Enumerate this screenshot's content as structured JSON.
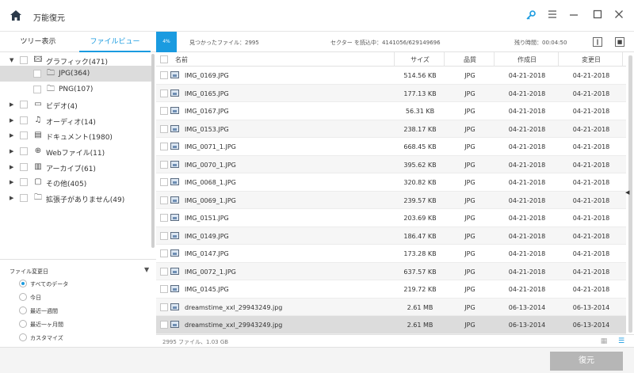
{
  "app": {
    "title": "万能復元"
  },
  "icons": {
    "home": "home-icon",
    "key": "key-icon",
    "menu": "menu-icon",
    "minimize": "minimize-icon",
    "maximize": "maximize-icon",
    "close": "close-icon"
  },
  "accent_color": "#1a9be0",
  "side_tabs": [
    {
      "label": "ツリー表示",
      "active": false
    },
    {
      "label": "ファイルビュー",
      "active": true
    }
  ],
  "tree": [
    {
      "label": "グラフィック(471)",
      "expanded": true,
      "icon": "image-folder-icon"
    },
    {
      "label": "JPG(364)",
      "child": true,
      "selected": true,
      "icon": "folder-icon"
    },
    {
      "label": "PNG(107)",
      "child": true,
      "icon": "folder-icon"
    },
    {
      "label": "ビデオ(4)",
      "icon": "video-icon"
    },
    {
      "label": "オーディオ(14)",
      "icon": "music-icon"
    },
    {
      "label": "ドキュメント(1980)",
      "icon": "document-icon"
    },
    {
      "label": "Webファイル(11)",
      "icon": "globe-icon"
    },
    {
      "label": "アーカイブ(61)",
      "icon": "archive-icon"
    },
    {
      "label": "その他(405)",
      "icon": "other-icon"
    },
    {
      "label": "拡張子がありません(49)",
      "icon": "no-extension-folder-icon"
    }
  ],
  "filter": {
    "title": "ファイル変更日",
    "options": [
      {
        "label": "すべてのデータ",
        "selected": true
      },
      {
        "label": "今日",
        "selected": false
      },
      {
        "label": "最近一週間",
        "selected": false
      },
      {
        "label": "最近一ヶ月間",
        "selected": false
      },
      {
        "label": "カスタマイズ",
        "selected": false
      }
    ]
  },
  "status": {
    "progress": "4%",
    "found": "見つかったファイル：2995",
    "sectors": "セクター を読込中：4141056/629149696",
    "remaining": "残り時間：00:04:50"
  },
  "table": {
    "columns": [
      "名前",
      "サイズ",
      "品質",
      "作成日",
      "変更日"
    ],
    "rows": [
      {
        "name": "IMG_0169.JPG",
        "size": "514.56 KB",
        "quality": "JPG",
        "created": "04-21-2018",
        "modified": "04-21-2018"
      },
      {
        "name": "IMG_0165.JPG",
        "size": "177.13 KB",
        "quality": "JPG",
        "created": "04-21-2018",
        "modified": "04-21-2018"
      },
      {
        "name": "IMG_0167.JPG",
        "size": "56.31 KB",
        "quality": "JPG",
        "created": "04-21-2018",
        "modified": "04-21-2018"
      },
      {
        "name": "IMG_0153.JPG",
        "size": "238.17 KB",
        "quality": "JPG",
        "created": "04-21-2018",
        "modified": "04-21-2018"
      },
      {
        "name": "IMG_0071_1.JPG",
        "size": "668.45 KB",
        "quality": "JPG",
        "created": "04-21-2018",
        "modified": "04-21-2018"
      },
      {
        "name": "IMG_0070_1.JPG",
        "size": "395.62 KB",
        "quality": "JPG",
        "created": "04-21-2018",
        "modified": "04-21-2018"
      },
      {
        "name": "IMG_0068_1.JPG",
        "size": "320.82 KB",
        "quality": "JPG",
        "created": "04-21-2018",
        "modified": "04-21-2018"
      },
      {
        "name": "IMG_0069_1.JPG",
        "size": "239.57 KB",
        "quality": "JPG",
        "created": "04-21-2018",
        "modified": "04-21-2018"
      },
      {
        "name": "IMG_0151.JPG",
        "size": "203.69 KB",
        "quality": "JPG",
        "created": "04-21-2018",
        "modified": "04-21-2018"
      },
      {
        "name": "IMG_0149.JPG",
        "size": "186.47 KB",
        "quality": "JPG",
        "created": "04-21-2018",
        "modified": "04-21-2018"
      },
      {
        "name": "IMG_0147.JPG",
        "size": "173.28 KB",
        "quality": "JPG",
        "created": "04-21-2018",
        "modified": "04-21-2018"
      },
      {
        "name": "IMG_0072_1.JPG",
        "size": "637.57 KB",
        "quality": "JPG",
        "created": "04-21-2018",
        "modified": "04-21-2018"
      },
      {
        "name": "IMG_0145.JPG",
        "size": "219.72 KB",
        "quality": "JPG",
        "created": "04-21-2018",
        "modified": "04-21-2018"
      },
      {
        "name": "dreamstime_xxl_29943249.jpg",
        "size": "2.61 MB",
        "quality": "JPG",
        "created": "06-13-2014",
        "modified": "06-13-2014"
      },
      {
        "name": "dreamstime_xxl_29943249.jpg",
        "size": "2.61 MB",
        "quality": "JPG",
        "created": "06-13-2014",
        "modified": "06-13-2014",
        "selected": true
      }
    ]
  },
  "footer": {
    "summary": "2995 ファイル、1.03 GB"
  },
  "bottom": {
    "recover_label": "復元"
  }
}
